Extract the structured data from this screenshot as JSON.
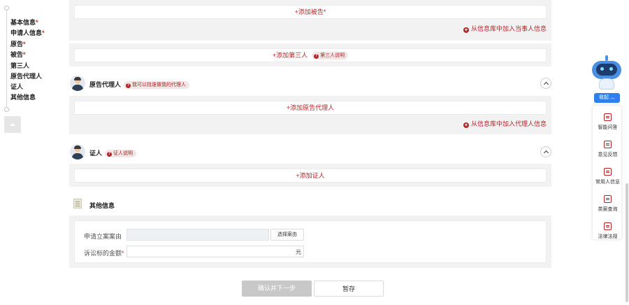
{
  "nav": {
    "items": [
      {
        "label": "基本信息",
        "required": "*"
      },
      {
        "label": "申请人信息",
        "required": "*"
      },
      {
        "label": "原告",
        "required": "*"
      },
      {
        "label": "被告",
        "required": "*"
      },
      {
        "label": "第三人",
        "required": ""
      },
      {
        "label": "原告代理人",
        "required": ""
      },
      {
        "label": "证人",
        "required": ""
      },
      {
        "label": "其他信息",
        "required": ""
      }
    ]
  },
  "defendant": {
    "add_label": "+添加被告",
    "required": "*",
    "db_link": "从信息库中加入当事人信息"
  },
  "third_party": {
    "add_label": "+添加第三人",
    "tag": "第三人说明"
  },
  "agent": {
    "title": "原告代理人",
    "tag": "我可以找谁做我的代理人",
    "add_label": "+添加原告代理人",
    "db_link": "从信息库中加入代理人信息"
  },
  "witness": {
    "title": "证人",
    "tag": "证人说明",
    "add_label": "+添加证人"
  },
  "other": {
    "title": "其他信息",
    "cause_label": "申请立案案由",
    "select_cause_button": "选择案由",
    "amount_label": "诉讼标的金额",
    "amount_required": "*",
    "amount_unit": "元"
  },
  "actions": {
    "confirm_label": "确认并下一步",
    "save_label": "暂存"
  },
  "sidebar_tools": {
    "collapse_label": "收起",
    "items": [
      {
        "label": "智能问答",
        "icon": "chat-icon"
      },
      {
        "label": "意见反馈",
        "icon": "feedback-icon"
      },
      {
        "label": "常用人信息",
        "icon": "contacts-icon"
      },
      {
        "label": "类案查询",
        "icon": "case-search-icon"
      },
      {
        "label": "法律法规",
        "icon": "law-book-icon"
      }
    ]
  },
  "colors": {
    "accent": "#b1262a",
    "primary_blue": "#2f80ed",
    "panel_bg": "#f2f2f2"
  }
}
